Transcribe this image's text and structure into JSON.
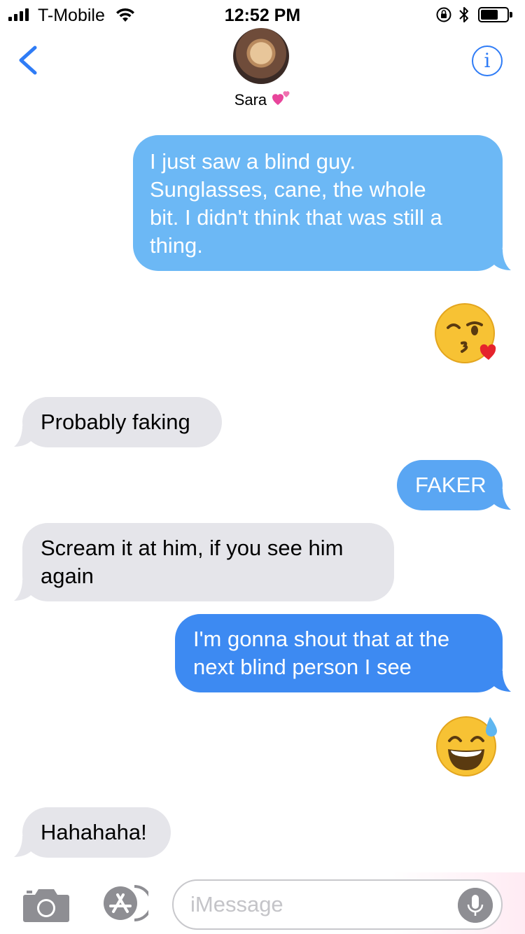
{
  "status_bar": {
    "carrier": "T-Mobile",
    "time": "12:52 PM"
  },
  "header": {
    "contact_name": "Sara",
    "name_emoji": "two-hearts-emoji",
    "info_label": "i"
  },
  "messages": [
    {
      "direction": "outgoing",
      "type": "text",
      "text": "I just saw a blind guy. Sunglasses, cane, the whole bit. I didn't think that was still a thing.",
      "lines": [
        "I just saw a blind guy.",
        "Sunglasses, cane, the whole",
        "bit. I didn't think that was still a",
        "thing."
      ],
      "color": "#6cb8f5"
    },
    {
      "direction": "outgoing",
      "type": "emoji",
      "emoji": "kissing-face-with-heart"
    },
    {
      "direction": "incoming",
      "type": "text",
      "text": "Probably faking"
    },
    {
      "direction": "outgoing",
      "type": "text",
      "text": "FAKER",
      "color": "#5aa6f3"
    },
    {
      "direction": "incoming",
      "type": "text",
      "text": "Scream it at him, if you see him again",
      "lines": [
        "Scream it at him, if you see him",
        "again"
      ]
    },
    {
      "direction": "outgoing",
      "type": "text",
      "text": "I'm gonna shout that at the next blind person I see",
      "lines": [
        "I'm gonna shout that at the",
        "next blind person I see"
      ],
      "color": "#3d8af2"
    },
    {
      "direction": "outgoing",
      "type": "emoji",
      "emoji": "grinning-face-with-sweat"
    },
    {
      "direction": "incoming",
      "type": "text",
      "text": "Hahahaha!"
    }
  ],
  "input_bar": {
    "placeholder": "iMessage"
  },
  "colors": {
    "ios_blue": "#2f7cf6",
    "incoming_bubble": "#e5e5ea"
  }
}
